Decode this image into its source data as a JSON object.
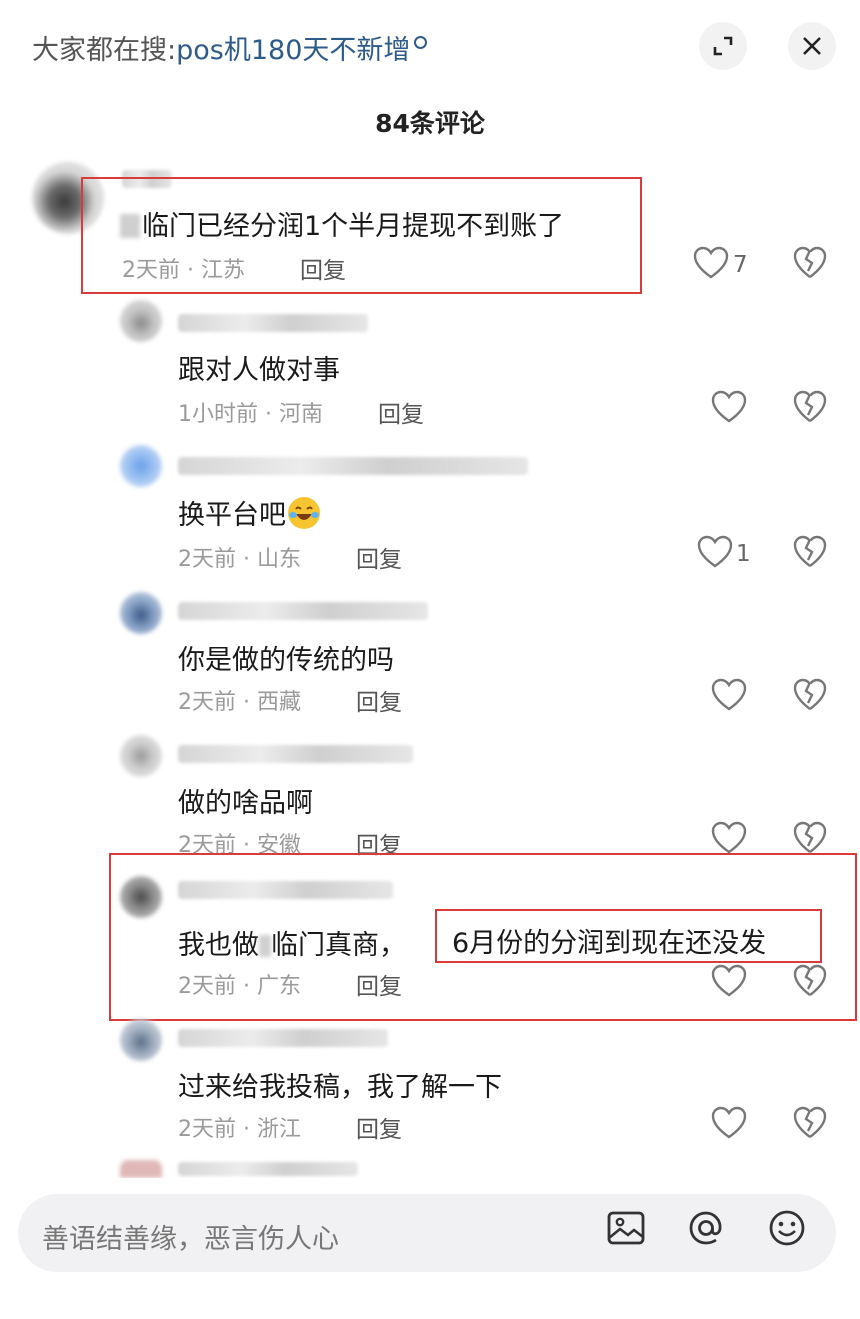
{
  "header": {
    "search_prefix": "大家都在搜:",
    "search_keyword": "pos机180天不新增",
    "comment_count_title": "84条评论"
  },
  "comments": [
    {
      "text": "临门已经分润1个半月提现不到账了",
      "time_location": "2天前 · 江苏",
      "reply_label": "回复",
      "likes": "7",
      "highlighted": true
    },
    {
      "text": "跟对人做对事",
      "time_location": "1小时前 · 河南",
      "reply_label": "回复",
      "likes": ""
    },
    {
      "text": "换平台吧",
      "time_location": "2天前 · 山东",
      "reply_label": "回复",
      "likes": "1",
      "emoji": "laughing-tears-emoji"
    },
    {
      "text": "你是做的传统的吗",
      "time_location": "2天前 · 西藏",
      "reply_label": "回复",
      "likes": ""
    },
    {
      "text": "做的啥品啊",
      "time_location": "2天前 · 安徽",
      "reply_label": "回复",
      "likes": ""
    },
    {
      "text_prefix": "我也做",
      "text_mid": "临门真商，",
      "text_boxed": "6月份的分润到现在还没发",
      "time_location": "2天前 · 广东",
      "reply_label": "回复",
      "likes": "",
      "highlighted": true
    },
    {
      "text": "过来给我投稿，我了解一下",
      "time_location": "2天前 · 浙江",
      "reply_label": "回复",
      "likes": ""
    }
  ],
  "footer": {
    "input_placeholder": "善语结善缘，恶言伤人心",
    "icons": [
      "image-icon",
      "at-icon",
      "emoji-icon"
    ]
  },
  "colors": {
    "highlight_box": "#d93a3a",
    "keyword": "#2d5b8a",
    "meta_text": "#9a9a9a"
  }
}
